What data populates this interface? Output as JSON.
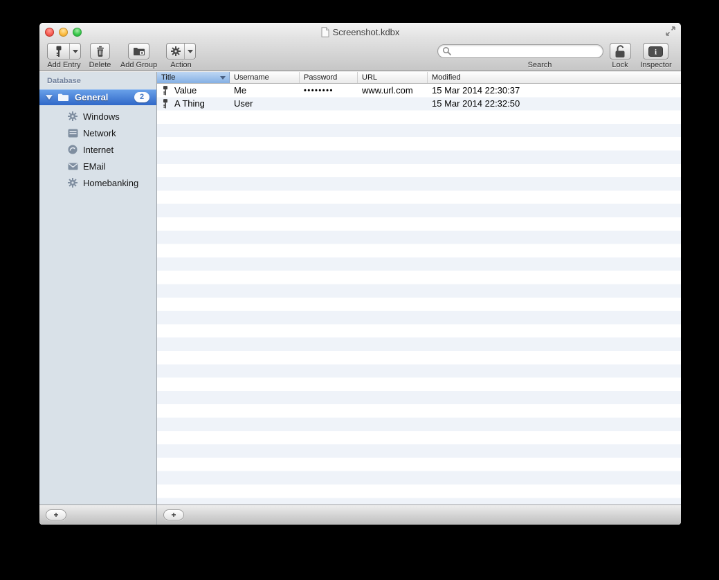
{
  "window": {
    "title": "Screenshot.kdbx"
  },
  "toolbar": {
    "add_entry_label": "Add Entry",
    "delete_label": "Delete",
    "add_group_label": "Add Group",
    "action_label": "Action",
    "search_label": "Search",
    "search_value": "",
    "lock_label": "Lock",
    "inspector_label": "Inspector"
  },
  "sidebar": {
    "header": "Database",
    "group": {
      "label": "General",
      "badge": "2",
      "expanded": true
    },
    "items": [
      {
        "label": "Windows",
        "icon": "gear"
      },
      {
        "label": "Network",
        "icon": "server"
      },
      {
        "label": "Internet",
        "icon": "globe"
      },
      {
        "label": "EMail",
        "icon": "envelope"
      },
      {
        "label": "Homebanking",
        "icon": "gear"
      }
    ]
  },
  "table": {
    "columns": [
      "Title",
      "Username",
      "Password",
      "URL",
      "Modified"
    ],
    "sorted_column": "Title",
    "sort_direction": "descending",
    "rows": [
      {
        "title": "Value",
        "username": "Me",
        "password": "••••••••",
        "url": "www.url.com",
        "modified": "15 Mar 2014 22:30:37"
      },
      {
        "title": "A Thing",
        "username": "User",
        "password": "",
        "url": "",
        "modified": "15 Mar 2014 22:32:50"
      }
    ]
  },
  "bottom_bars": {
    "sidebar_add_label": "+",
    "content_add_label": "+"
  },
  "icons": {
    "add_entry": "key-icon",
    "delete": "trash-icon",
    "add_group": "folder-plus-icon",
    "action": "gear-icon",
    "search": "magnifier-icon",
    "lock": "padlock-open-icon",
    "inspector": "info-panel-icon",
    "entry_row": "key-icon",
    "fullscreen": "diagonal-arrows-icon",
    "title_document": "document-icon"
  },
  "colors": {
    "selection_blue_top": "#6aa2ea",
    "selection_blue_bottom": "#3068c8",
    "header_selected_top": "#bdd6f4",
    "header_selected_bottom": "#85b0e4",
    "row_stripe": "#eff3f9",
    "sidebar_bg": "#d9e1e8"
  }
}
